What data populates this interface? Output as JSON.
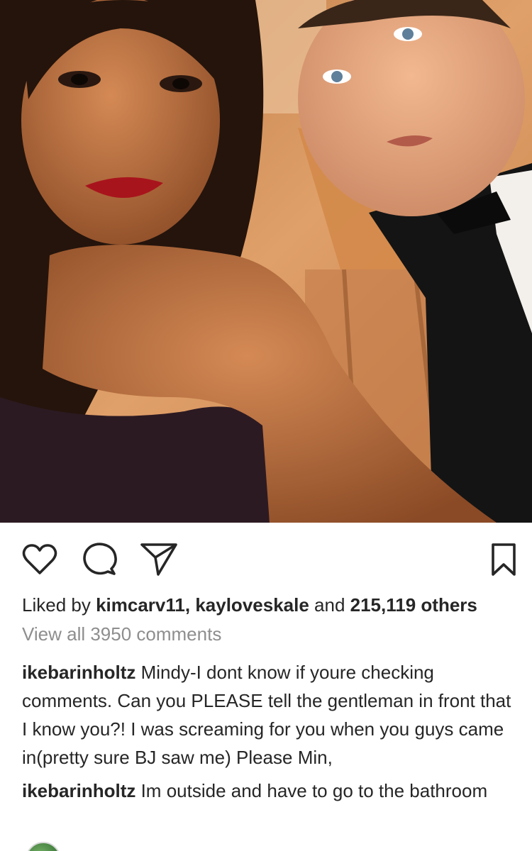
{
  "post": {
    "image_alt": "selfie",
    "liked_prefix": "Liked by ",
    "liked_user1": "kimcarv11",
    "liked_sep": ", ",
    "liked_user2": "kayloveskale",
    "liked_and": " and ",
    "liked_count": "215,119 others",
    "view_comments": "View all 3950 comments"
  },
  "actions": {
    "like_icon": "heart-icon",
    "comment_icon": "comment-icon",
    "share_icon": "send-icon",
    "save_icon": "bookmark-icon"
  },
  "comments": [
    {
      "user": "ikebarinholtz",
      "text": " Mindy-I dont know if youre checking comments. Can you PLEASE tell the gentleman in front that I know you?! I was screaming for you when you guys came in(pretty sure BJ saw me) Please Min,"
    },
    {
      "user": "ikebarinholtz",
      "text": " Im outside and have to go to the bathroom"
    }
  ]
}
